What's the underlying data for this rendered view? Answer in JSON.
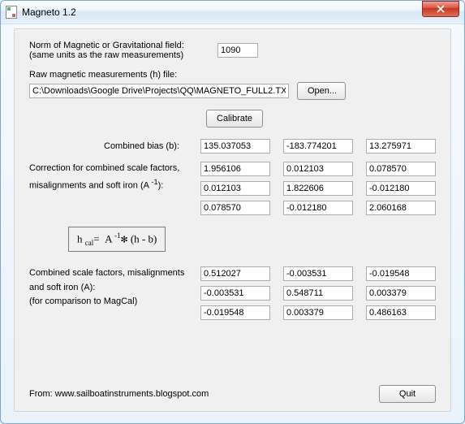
{
  "window": {
    "title": "Magneto 1.2"
  },
  "norm": {
    "label_line1": "Norm of Magnetic or Gravitational field:",
    "label_line2": "(same units as the raw measurements)",
    "value": "1090"
  },
  "file": {
    "label": "Raw magnetic measurements (h) file:",
    "path": "C:\\Downloads\\Google Drive\\Projects\\QQ\\MAGNETO_FULL2.TX",
    "open_label": "Open..."
  },
  "calibrate_label": "Calibrate",
  "bias": {
    "label": "Combined bias (b):",
    "values": [
      "135.037053",
      "-183.774201",
      "13.275971"
    ]
  },
  "ainv": {
    "label_line1": "Correction for combined scale factors,",
    "label_line2_html": "misalignments and soft iron (A <sup>-1</sup>):",
    "matrix": [
      [
        "1.956106",
        "0.012103",
        "0.078570"
      ],
      [
        "0.012103",
        "1.822606",
        "-0.012180"
      ],
      [
        "0.078570",
        "-0.012180",
        "2.060168"
      ]
    ]
  },
  "formula_html": "h <sub>cal</sub>=&nbsp;&nbsp;A <sup>-1</sup><small>✻</small> (h - b)",
  "a": {
    "label_line1": "Combined scale factors, misalignments",
    "label_line2": "and soft iron (A):",
    "label_line3": "(for comparison to MagCal)",
    "matrix": [
      [
        "0.512027",
        "-0.003531",
        "-0.019548"
      ],
      [
        "-0.003531",
        "0.548711",
        "0.003379"
      ],
      [
        "-0.019548",
        "0.003379",
        "0.486163"
      ]
    ]
  },
  "footer": {
    "from": "From: www.sailboatinstruments.blogspot.com",
    "quit_label": "Quit"
  }
}
